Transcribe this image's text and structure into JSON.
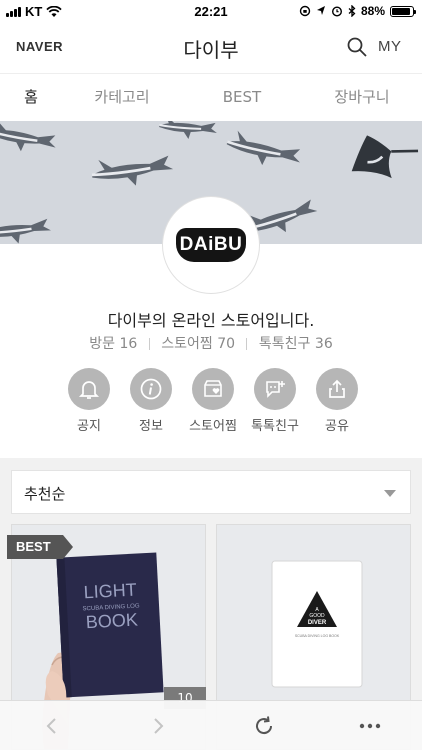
{
  "status_bar": {
    "carrier": "KT",
    "time": "22:21",
    "battery_percent": "88%",
    "battery_level": 0.88
  },
  "header": {
    "brand": "NAVER",
    "title": "다이부",
    "my_label": "MY"
  },
  "tabs": [
    {
      "label": "홈",
      "active": true
    },
    {
      "label": "카테고리",
      "active": false
    },
    {
      "label": "BEST",
      "active": false
    },
    {
      "label": "장바구니",
      "active": false
    }
  ],
  "profile": {
    "logo_text": "DAiBU",
    "intro": "다이부의 온라인 스토어입니다.",
    "stats": [
      {
        "label": "방문",
        "value": "16"
      },
      {
        "label": "스토어찜",
        "value": "70"
      },
      {
        "label": "톡톡친구",
        "value": "36"
      }
    ]
  },
  "actions": [
    {
      "label": "공지",
      "icon": "bell-icon"
    },
    {
      "label": "정보",
      "icon": "info-icon"
    },
    {
      "label": "스토어찜",
      "icon": "store-heart-icon"
    },
    {
      "label": "톡톡친구",
      "icon": "chat-plus-icon"
    },
    {
      "label": "공유",
      "icon": "share-icon"
    }
  ],
  "sort": {
    "selected": "추천순"
  },
  "products": [
    {
      "badge": "BEST",
      "cover_line1": "LIGHT",
      "cover_small": "SCUBA DIVING LOG",
      "cover_line2": "BOOK",
      "count": "10"
    },
    {
      "cover_small_1": "A",
      "cover_small_2": "GOOD",
      "cover_title": "DIVER",
      "cover_footer": "SCUBA DIVING LOG BOOK"
    }
  ],
  "colors": {
    "cover_bg": "#d3d7dd",
    "action_circle": "#b6b6b6",
    "section_bg": "#f1f1f1",
    "badge_bg": "#555555"
  }
}
